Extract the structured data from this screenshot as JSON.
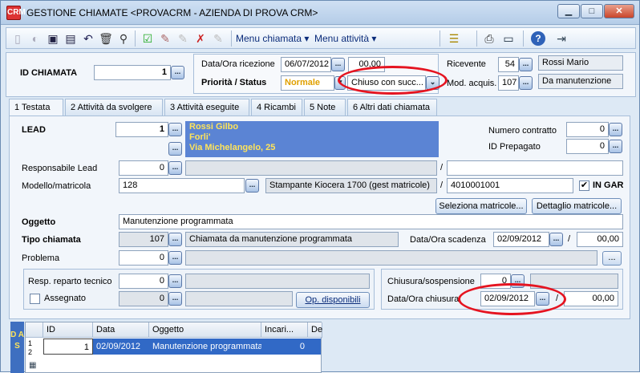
{
  "window": {
    "title": "GESTIONE CHIAMATE <PROVACRM - AZIENDA DI PROVA CRM>",
    "app_icon": "CRM"
  },
  "toolbar": {
    "menu_chiamata": "Menu chiamata ▾",
    "menu_attivita": "Menu attività ▾"
  },
  "header": {
    "id_chiamata_label": "ID CHIAMATA",
    "id_chiamata_value": "1",
    "data_ora_label": "Data/Ora ricezione",
    "data_value": "06/07/2012",
    "ora_value": "00,00",
    "priorita_label": "Priorità / Status",
    "priorita_value": "Normale",
    "status_value": "Chiuso con succ...",
    "ricevente_label": "Ricevente",
    "ricevente_code": "54",
    "ricevente_name": "Rossi Mario",
    "mod_acquis_label": "Mod. acquis.",
    "mod_acquis_code": "107",
    "mod_acquis_name": "Da manutenzione"
  },
  "tabs": [
    "1 Testata",
    "2 Attività da svolgere",
    "3 Attività eseguite",
    "4 Ricambi",
    "5 Note",
    "6 Altri dati chiamata"
  ],
  "testata": {
    "lead_label": "LEAD",
    "lead_value": "1",
    "lead_lines": [
      "Rossi Gilbo",
      "Forli'",
      "Via Michelangelo, 25"
    ],
    "numero_contratto_label": "Numero contratto",
    "numero_contratto_value": "0",
    "id_prepagato_label": "ID Prepagato",
    "id_prepagato_value": "0",
    "responsabile_label": "Responsabile Lead",
    "responsabile_value": "0",
    "slash": "/",
    "modello_label": "Modello/matricola",
    "modello_value": "128",
    "modello_desc": "Stampante Kiocera 1700  (gest matricole)",
    "matricola_value": "4010001001",
    "in_gar_label": "IN GAR",
    "in_gar_checked": "✔",
    "seleziona_btn": "Seleziona matricole...",
    "dettaglio_btn": "Dettaglio matricole...",
    "oggetto_label": "Oggetto",
    "oggetto_value": "Manutenzione programmata",
    "tipo_label": "Tipo chiamata",
    "tipo_code": "107",
    "tipo_desc": "Chiamata da manutenzione programmata",
    "scadenza_label": "Data/Ora scadenza",
    "scadenza_data": "02/09/2012",
    "scadenza_ora": "00,00",
    "problema_label": "Problema",
    "problema_value": "0",
    "resp_tecnico_label": "Resp. reparto tecnico",
    "resp_tecnico_value": "0",
    "assegnato_label": "Assegnato",
    "assegnato_value": "0",
    "op_disponibili_btn": "Op. disponibili",
    "chiusura_sosp_label": "Chiusura/sospensione",
    "chiusura_sosp_value": "0",
    "chiusura_label": "Data/Ora chiusura",
    "chiusura_data": "02/09/2012",
    "chiusura_ora": "00,00",
    "ellipsis": "..."
  },
  "side_bar": {
    "text": "D A S"
  },
  "grid": {
    "columns": [
      "ID",
      "Data",
      "Oggetto",
      "Incari...",
      "De"
    ],
    "row_numbers": [
      "1",
      "2"
    ],
    "row": {
      "id": "1",
      "data": "02/09/2012",
      "oggetto": "Manutenzione programmata",
      "incaricati": "0"
    }
  },
  "colors": {
    "status_highlight": "#e51420",
    "lead_bg": "#5b84d4",
    "lead_text": "#ffe45a",
    "priorita": "#e0a000"
  }
}
